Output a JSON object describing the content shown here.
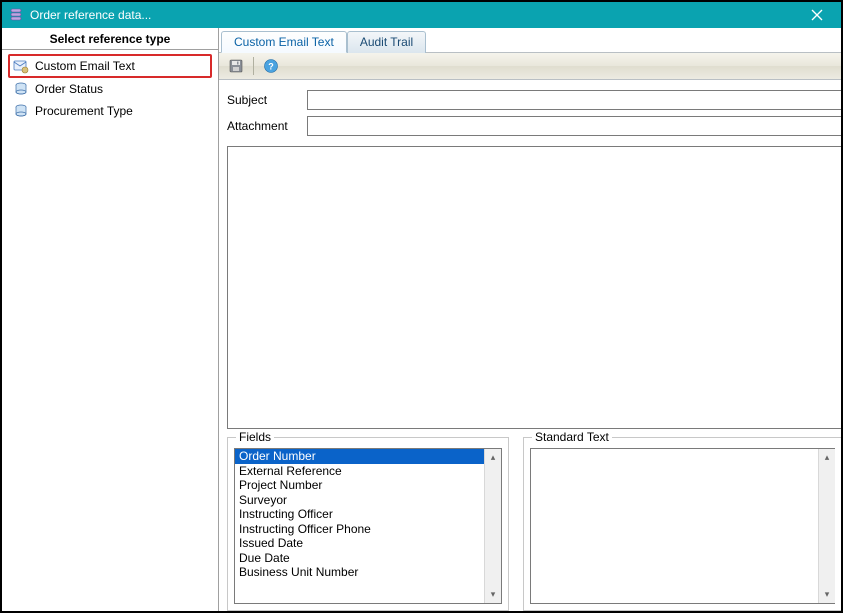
{
  "window": {
    "title": "Order reference data..."
  },
  "sidebar": {
    "header": "Select reference type",
    "items": [
      {
        "label": "Custom Email Text",
        "highlight": true
      },
      {
        "label": "Order Status",
        "highlight": false
      },
      {
        "label": "Procurement Type",
        "highlight": false
      }
    ]
  },
  "tabs": [
    {
      "label": "Custom Email Text",
      "active": true
    },
    {
      "label": "Audit Trail",
      "active": false
    }
  ],
  "form": {
    "subject_label": "Subject",
    "subject_value": "",
    "attachment_label": "Attachment",
    "attachment_value": ""
  },
  "groupboxes": {
    "fields_label": "Fields",
    "standard_label": "Standard Text"
  },
  "fields_list": {
    "selected_index": 0,
    "items": [
      "Order Number",
      "External Reference",
      "Project Number",
      "Surveyor",
      "Instructing Officer",
      "Instructing Officer Phone",
      "Issued Date",
      "Due Date",
      "Business Unit Number"
    ]
  },
  "standard_text": {
    "value": ""
  },
  "icons": {
    "app": "db-icon",
    "close": "close-icon",
    "save": "disk-icon",
    "help": "help-icon"
  }
}
